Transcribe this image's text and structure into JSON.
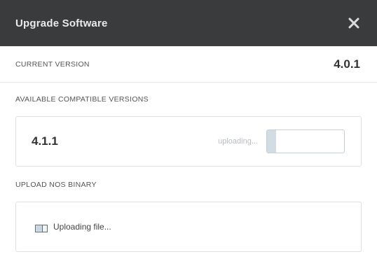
{
  "dialog": {
    "title": "Upgrade Software",
    "close_icon": "close-icon"
  },
  "current_version": {
    "label": "CURRENT VERSION",
    "value": "4.0.1"
  },
  "available": {
    "label": "AVAILABLE COMPATIBLE VERSIONS",
    "versions": [
      {
        "name": "4.1.1",
        "status": "uploading...",
        "progress": 0.12
      }
    ]
  },
  "upload_binary": {
    "label": "UPLOAD NOS BINARY",
    "status_icon": "upload-progress-icon",
    "status_text": "Uploading file..."
  },
  "colors": {
    "header_bg": "#3a3b3c",
    "progress_fill": "#d2dce3",
    "border": "#dfe2e5"
  }
}
